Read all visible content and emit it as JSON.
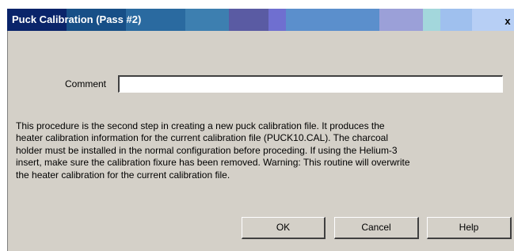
{
  "window": {
    "title": "Puck Calibration (Pass #2)",
    "close_glyph": "x"
  },
  "form": {
    "comment_label": "Comment",
    "comment_value": ""
  },
  "description_lines": [
    "This procedure is the second step in creating a new puck calibration file.  It produces the",
    "heater calibration information for the current calibration file (PUCK10.CAL).  The charcoal",
    "holder must be installed in the normal configuration before proceding. If using the Helium-3",
    "insert, make sure the calibration fixure has been removed.  Warning: This routine will overwrite",
    "the heater calibration for the current calibration file."
  ],
  "buttons": {
    "ok_label": "OK",
    "cancel_label": "Cancel",
    "help_label": "Help"
  },
  "colors": {
    "dialog_face": "#d4d0c8",
    "titlebar_dark": "#0a246a",
    "title_text": "#ffffff"
  }
}
